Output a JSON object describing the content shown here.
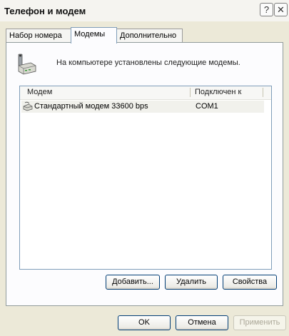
{
  "window": {
    "title": "Телефон и модем",
    "help_label": "?",
    "close_label": "✕"
  },
  "tabs": [
    {
      "label": "Набор номера",
      "active": false
    },
    {
      "label": "Модемы",
      "active": true
    },
    {
      "label": "Дополнительно",
      "active": false
    }
  ],
  "info_text": "На компьютере установлены следующие модемы.",
  "list": {
    "headers": [
      "Модем",
      "Подключен к"
    ],
    "rows": [
      {
        "name": "Стандартный модем 33600 bps",
        "port": "COM1",
        "icon": "modem-icon"
      }
    ]
  },
  "panel_buttons": {
    "add": "Добавить...",
    "remove": "Удалить",
    "properties": "Свойства"
  },
  "dialog_buttons": {
    "ok": "OK",
    "cancel": "Отмена",
    "apply": "Применить"
  },
  "colors": {
    "dialog_bg": "#ece9d8",
    "tab_active_border": "#7f9db9",
    "button_border": "#003c74",
    "disabled_text": "#aca899"
  }
}
